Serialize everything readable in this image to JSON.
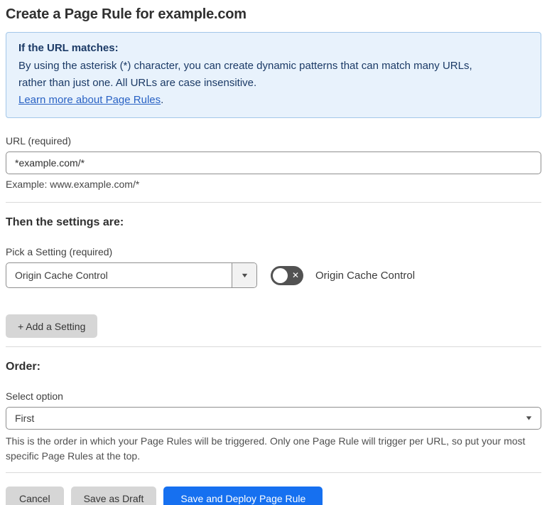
{
  "page": {
    "title": "Create a Page Rule for example.com"
  },
  "info_box": {
    "heading": "If the URL matches:",
    "body": "By using the asterisk (*) character, you can create dynamic patterns that can match many URLs, rather than just one. All URLs are case insensitive.",
    "link_label": "Learn more about Page Rules",
    "link_suffix": "."
  },
  "url_section": {
    "label": "URL (required)",
    "input_value": "*example.com/*",
    "example": "Example: www.example.com/*"
  },
  "settings_section": {
    "heading": "Then the settings are:",
    "pick_label": "Pick a Setting (required)",
    "selected_setting": "Origin Cache Control",
    "toggle_label": "Origin Cache Control",
    "toggle_state": "off",
    "add_setting_label": "+ Add a Setting"
  },
  "order_section": {
    "heading": "Order:",
    "select_label": "Select option",
    "selected_option": "First",
    "help_text": "This is the order in which your Page Rules will be triggered. Only one Page Rule will trigger per URL, so put your most specific Page Rules at the top."
  },
  "footer": {
    "cancel_label": "Cancel",
    "save_draft_label": "Save as Draft",
    "save_deploy_label": "Save and Deploy Page Rule"
  },
  "icons": {
    "caret_down": "▼",
    "toggle_off_glyph": "✕"
  },
  "colors": {
    "accent_blue": "#1670f0",
    "info_bg": "#e8f2fc",
    "info_border": "#a3c7e9",
    "info_text": "#1b3a66",
    "link_blue": "#2962c4",
    "toggle_off_bg": "#525252",
    "button_gray_bg": "#d6d6d6"
  }
}
